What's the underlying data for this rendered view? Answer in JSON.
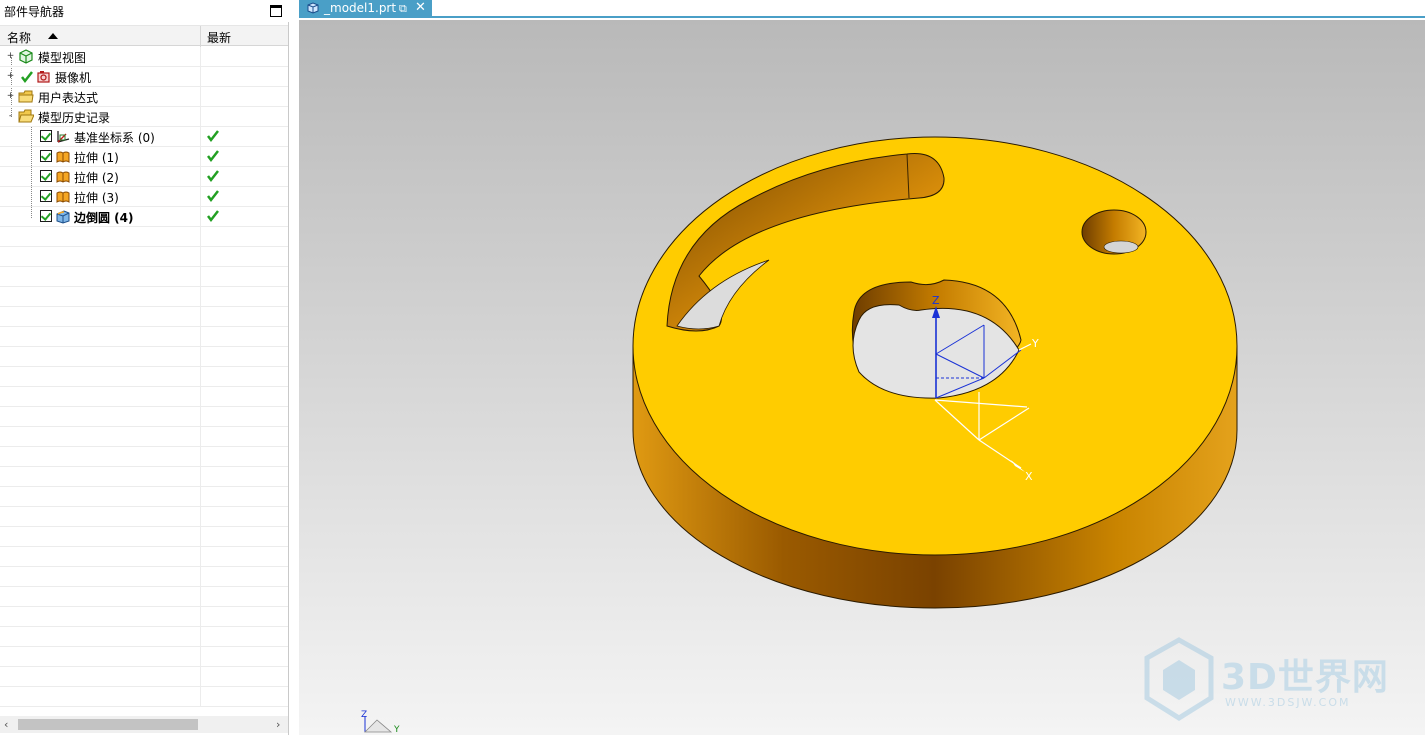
{
  "navigator": {
    "title": "部件导航器",
    "columns": {
      "name": "名称",
      "latest": "最新"
    },
    "items": [
      {
        "label": "模型视图",
        "expander": "+",
        "icon": "model-views-icon",
        "checked": null,
        "latest": false,
        "bold": false,
        "level": 0
      },
      {
        "label": "摄像机",
        "expander": "+",
        "icon": "camera-icon",
        "checked": null,
        "latest": false,
        "bold": false,
        "level": 0
      },
      {
        "label": "用户表达式",
        "expander": "+",
        "icon": "folder-icon",
        "checked": null,
        "latest": false,
        "bold": false,
        "level": 0
      },
      {
        "label": "模型历史记录",
        "expander": "-",
        "icon": "folder-open-icon",
        "checked": null,
        "latest": false,
        "bold": false,
        "level": 0
      },
      {
        "label": "基准坐标系 (0)",
        "expander": "",
        "icon": "datum-csys-icon",
        "checked": true,
        "latest": true,
        "bold": false,
        "level": 1
      },
      {
        "label": "拉伸 (1)",
        "expander": "",
        "icon": "extrude-icon",
        "checked": true,
        "latest": true,
        "bold": false,
        "level": 1
      },
      {
        "label": "拉伸 (2)",
        "expander": "",
        "icon": "extrude-icon",
        "checked": true,
        "latest": true,
        "bold": false,
        "level": 1
      },
      {
        "label": "拉伸 (3)",
        "expander": "",
        "icon": "extrude-icon",
        "checked": true,
        "latest": true,
        "bold": false,
        "level": 1
      },
      {
        "label": "边倒圆 (4)",
        "expander": "",
        "icon": "edge-blend-icon",
        "checked": true,
        "latest": true,
        "bold": true,
        "level": 1
      }
    ]
  },
  "tab": {
    "label": "_model1.prt",
    "active": true
  },
  "viewport": {
    "axis_labels": {
      "x": "X",
      "y": "Y",
      "z": "Z"
    },
    "part_color": "#ffcc00",
    "wall_color": "#b97a00"
  },
  "watermark": {
    "text": "3D世界网",
    "sub": "WWW.3DSJW.COM"
  },
  "colors": {
    "accent": "#4a9fc7",
    "check": "#23a023"
  }
}
